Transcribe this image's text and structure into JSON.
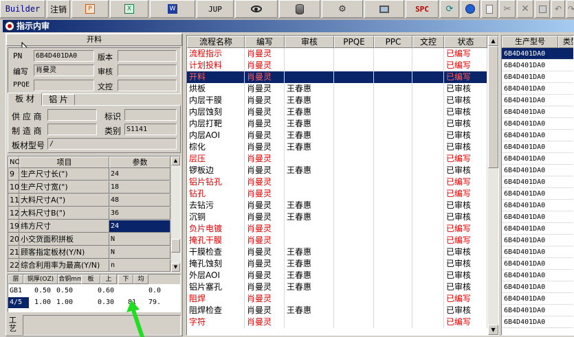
{
  "toolbar": {
    "app_label": "Builder",
    "logout_label": "注销",
    "jup_label": "JUP",
    "spc_label": "SPC",
    "colors": {
      "spc": "#c00000",
      "excel": "#107c41",
      "word": "#1f3f9f",
      "ppt": "#c55a11"
    }
  },
  "window": {
    "title": "指示内审"
  },
  "form": {
    "section_title": "开料",
    "pn_label": "PN",
    "pn_value": "6B4D401DA0",
    "version_label": "版本",
    "version_value": "",
    "author_label": "编写",
    "author_value": "肖曼灵",
    "review_label": "审核",
    "review_value": "",
    "ppqe_label": "PPQE",
    "ppqe_value": "",
    "wenkong_label": "文控",
    "wenkong_value": ""
  },
  "tabs": [
    {
      "label": "板 材"
    },
    {
      "label": "铝 片"
    }
  ],
  "material": {
    "supplier_label": "供 应 商",
    "supplier_value": "",
    "mark_label": "标识",
    "mark_value": "",
    "manufacturer_label": "制 造 商",
    "manufacturer_value": "",
    "category_label": "类别",
    "category_value": "S1141",
    "type_label": "板材型号",
    "type_value": "/"
  },
  "param_table": {
    "col_no": "NO",
    "col_item": "项目",
    "col_param": "参数",
    "rows": [
      {
        "no": "9",
        "item": "生产尺寸长(\")",
        "val": "24"
      },
      {
        "no": "10",
        "item": "生产尺寸宽(\")",
        "val": "18"
      },
      {
        "no": "11",
        "item": "大料尺寸A(\")",
        "val": "48"
      },
      {
        "no": "12",
        "item": "大料尺寸B(\")",
        "val": "36"
      },
      {
        "no": "19",
        "item": "纬方尺寸",
        "val": "24",
        "selected": true
      },
      {
        "no": "20",
        "item": "小交货面积拼板",
        "val": "N"
      },
      {
        "no": "21",
        "item": "顾客指定板材(Y/N)",
        "val": "N"
      },
      {
        "no": "22",
        "item": "综合利用率为最高(Y/N)",
        "val": "n"
      }
    ]
  },
  "layer_table": {
    "headers": [
      "层",
      "铜厚(OZ)",
      "合铜mm",
      "板mm",
      "上",
      "下",
      "均"
    ],
    "rows": [
      {
        "cells": [
          "GB1",
          "0.50",
          "0.50",
          "",
          "0.60",
          "",
          "",
          "0.0"
        ],
        "selected": false
      },
      {
        "cells": [
          "4/5",
          "1.00",
          "1.00",
          "",
          "0.30",
          "",
          "81",
          "79."
        ],
        "selected": true
      }
    ]
  },
  "bottom": {
    "label": "工艺"
  },
  "process_table": {
    "headers": [
      "流程名称",
      "编写",
      "审核",
      "PPQE",
      "PPC",
      "文控",
      "状态"
    ],
    "rows": [
      {
        "name": "流程指示",
        "author": "肖曼灵",
        "reviewer": "",
        "status": "已编写",
        "color": "red"
      },
      {
        "name": "计划投料",
        "author": "肖曼灵",
        "reviewer": "",
        "status": "已编写",
        "color": "red"
      },
      {
        "name": "开料",
        "author": "肖曼灵",
        "reviewer": "",
        "status": "已编写",
        "color": "red",
        "selected": true
      },
      {
        "name": "烘板",
        "author": "肖曼灵",
        "reviewer": "王春惠",
        "status": "已审核",
        "color": "black"
      },
      {
        "name": "内层干膜",
        "author": "肖曼灵",
        "reviewer": "王春惠",
        "status": "已审核",
        "color": "black"
      },
      {
        "name": "内层蚀刻",
        "author": "肖曼灵",
        "reviewer": "王春惠",
        "status": "已审核",
        "color": "black"
      },
      {
        "name": "内层打靶",
        "author": "肖曼灵",
        "reviewer": "王春惠",
        "status": "已审核",
        "color": "black"
      },
      {
        "name": "内层AOI",
        "author": "肖曼灵",
        "reviewer": "王春惠",
        "status": "已审核",
        "color": "black"
      },
      {
        "name": "棕化",
        "author": "肖曼灵",
        "reviewer": "王春惠",
        "status": "已审核",
        "color": "black"
      },
      {
        "name": "层压",
        "author": "肖曼灵",
        "reviewer": "",
        "status": "已编写",
        "color": "red"
      },
      {
        "name": "锣板边",
        "author": "肖曼灵",
        "reviewer": "王春惠",
        "status": "已审核",
        "color": "black"
      },
      {
        "name": "铝片钻孔",
        "author": "肖曼灵",
        "reviewer": "",
        "status": "已编写",
        "color": "red"
      },
      {
        "name": "钻孔",
        "author": "肖曼灵",
        "reviewer": "",
        "status": "已编写",
        "color": "red"
      },
      {
        "name": "去钻污",
        "author": "肖曼灵",
        "reviewer": "王春惠",
        "status": "已审核",
        "color": "black"
      },
      {
        "name": "沉铜",
        "author": "肖曼灵",
        "reviewer": "王春惠",
        "status": "已审核",
        "color": "black"
      },
      {
        "name": "负片电镀",
        "author": "肖曼灵",
        "reviewer": "",
        "status": "已编写",
        "color": "red"
      },
      {
        "name": "掩孔干膜",
        "author": "肖曼灵",
        "reviewer": "",
        "status": "已编写",
        "color": "red"
      },
      {
        "name": "干膜检查",
        "author": "肖曼灵",
        "reviewer": "王春惠",
        "status": "已审核",
        "color": "black"
      },
      {
        "name": "掩孔蚀刻",
        "author": "肖曼灵",
        "reviewer": "王春惠",
        "status": "已审核",
        "color": "black"
      },
      {
        "name": "外层AOI",
        "author": "肖曼灵",
        "reviewer": "王春惠",
        "status": "已审核",
        "color": "black"
      },
      {
        "name": "铝片塞孔",
        "author": "肖曼灵",
        "reviewer": "王春惠",
        "status": "已审核",
        "color": "black"
      },
      {
        "name": "阻焊",
        "author": "肖曼灵",
        "reviewer": "",
        "status": "已编写",
        "color": "red"
      },
      {
        "name": "阻焊检查",
        "author": "肖曼灵",
        "reviewer": "王春惠",
        "status": "已审核",
        "color": "black"
      },
      {
        "name": "字符",
        "author": "肖曼灵",
        "reviewer": "",
        "status": "已编写",
        "color": "red"
      }
    ]
  },
  "right_table": {
    "col1": "生产型号",
    "col2": "类型",
    "rows": [
      "6B4D401DA0",
      "6B4D401DA0",
      "6B4D401DA0",
      "6B4D401DA0",
      "6B4D401DA0",
      "6B4D401DA0",
      "6B4D401DA0",
      "6B4D401DA0",
      "6B4D401DA0",
      "6B4D401DA0",
      "6B4D401DA0",
      "6B4D401DA0",
      "6B4D401DA0",
      "6B4D401DA0",
      "6B4D401DA0",
      "6B4D401DA0",
      "6B4D401DA0",
      "6B4D401DA0",
      "6B4D401DA0",
      "6B4D401DA0",
      "6B4D401DA0",
      "6B4D401DA0",
      "6B4D401DA0",
      "6B4D401DA0"
    ]
  }
}
